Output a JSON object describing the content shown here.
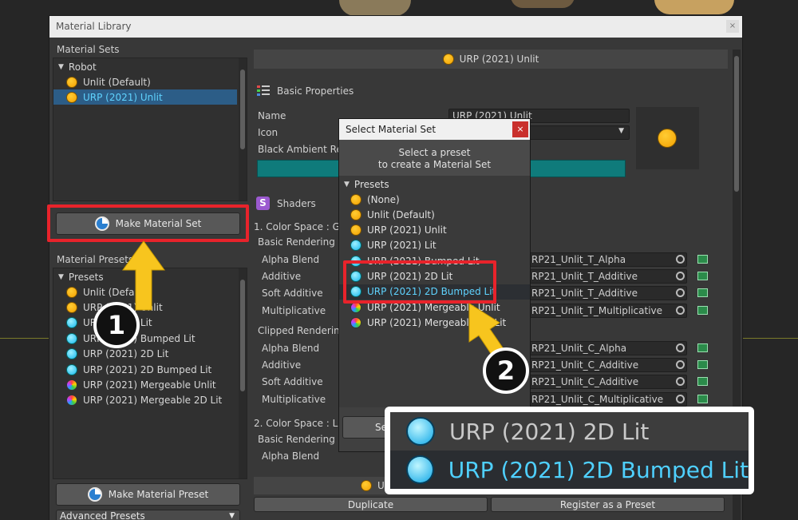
{
  "window": {
    "title": "Material Library",
    "close_glyph": "×"
  },
  "left": {
    "sets_label": "Material Sets",
    "sets_tree": {
      "root": "Robot",
      "items": [
        {
          "label": "Unlit (Default)",
          "icon": "orange",
          "selected": false
        },
        {
          "label": "URP (2021) Unlit",
          "icon": "orange",
          "selected": true
        }
      ]
    },
    "make_set_button": "Make Material Set",
    "presets_label": "Material Presets",
    "presets_tree": {
      "root": "Presets",
      "items": [
        {
          "label": "Unlit (Default)",
          "icon": "orange"
        },
        {
          "label": "URP (2021) Unlit",
          "icon": "orange"
        },
        {
          "label": "URP (2021) Lit",
          "icon": "blue"
        },
        {
          "label": "URP (2021) Bumped Lit",
          "icon": "blue"
        },
        {
          "label": "URP (2021) 2D Lit",
          "icon": "blue"
        },
        {
          "label": "URP (2021) 2D Bumped Lit",
          "icon": "blue"
        },
        {
          "label": "URP (2021) Mergeable Unlit",
          "icon": "rainbow"
        },
        {
          "label": "URP (2021) Mergeable 2D Lit",
          "icon": "rainbow"
        }
      ]
    },
    "make_preset_button": "Make Material Preset",
    "advanced_presets": "Advanced Presets"
  },
  "right": {
    "header_title": "URP (2021) Unlit",
    "basic_properties": "Basic Properties",
    "name_label": "Name",
    "name_value": "URP (2021) Unlit",
    "icon_label": "Icon",
    "black_ambient_label": "Black Ambient Rec",
    "shaders_label": "Shaders",
    "color_space_gamma": "1. Color Space : Gan",
    "color_space_linear": "2. Color Space : Line",
    "basic_rendering": "Basic Rendering",
    "clipped_rendering": "Clipped Rendering",
    "basic_rows": [
      {
        "label": "Alpha Blend",
        "value": "RP21_Unlit_T_Alpha"
      },
      {
        "label": "Additive",
        "value": "RP21_Unlit_T_Additive"
      },
      {
        "label": "Soft Additive",
        "value": "RP21_Unlit_T_Additive"
      },
      {
        "label": "Multiplicative",
        "value": "RP21_Unlit_T_Multiplicative"
      }
    ],
    "clipped_rows": [
      {
        "label": "Alpha Blend",
        "value": "RP21_Unlit_C_Alpha"
      },
      {
        "label": "Additive",
        "value": "RP21_Unlit_C_Additive"
      },
      {
        "label": "Soft Additive",
        "value": "RP21_Unlit_C_Additive"
      },
      {
        "label": "Multiplicative",
        "value": "RP21_Unlit_C_Multiplicative"
      }
    ],
    "linear_alpha_blend": "Alpha Blend",
    "bottom_title_fragment": "U",
    "duplicate_button": "Duplicate",
    "register_button": "Register as a Preset"
  },
  "dialog": {
    "title": "Select Material Set",
    "close_glyph": "×",
    "header_line1": "Select a preset",
    "header_line2": "to create a Material Set",
    "tree_root": "Presets",
    "items": [
      {
        "label": "(None)",
        "icon": "orange"
      },
      {
        "label": "Unlit (Default)",
        "icon": "orange"
      },
      {
        "label": "URP (2021) Unlit",
        "icon": "orange"
      },
      {
        "label": "URP (2021) Lit",
        "icon": "blue"
      },
      {
        "label": "URP (2021) Bumped Lit",
        "icon": "blue"
      },
      {
        "label": "URP (2021) 2D Lit",
        "icon": "blue"
      },
      {
        "label": "URP (2021) 2D Bumped Lit",
        "icon": "blue",
        "selected": true
      },
      {
        "label": "URP (2021) Mergeable Unlit",
        "icon": "rainbow"
      },
      {
        "label": "URP (2021) Mergeable 2D Lit",
        "icon": "rainbow"
      }
    ],
    "select_button_fragment": "Se"
  },
  "zoom": {
    "items": [
      {
        "label": "URP (2021) 2D Lit",
        "selected": false
      },
      {
        "label": "URP (2021) 2D Bumped Lit",
        "selected": true
      }
    ]
  },
  "steps": {
    "one": "1",
    "two": "2"
  },
  "colors": {
    "accent_text": "#5fd3ff",
    "highlight_box": "#e8232b",
    "arrow": "#f7c51e",
    "teal_bar": "#0f7b7b"
  }
}
